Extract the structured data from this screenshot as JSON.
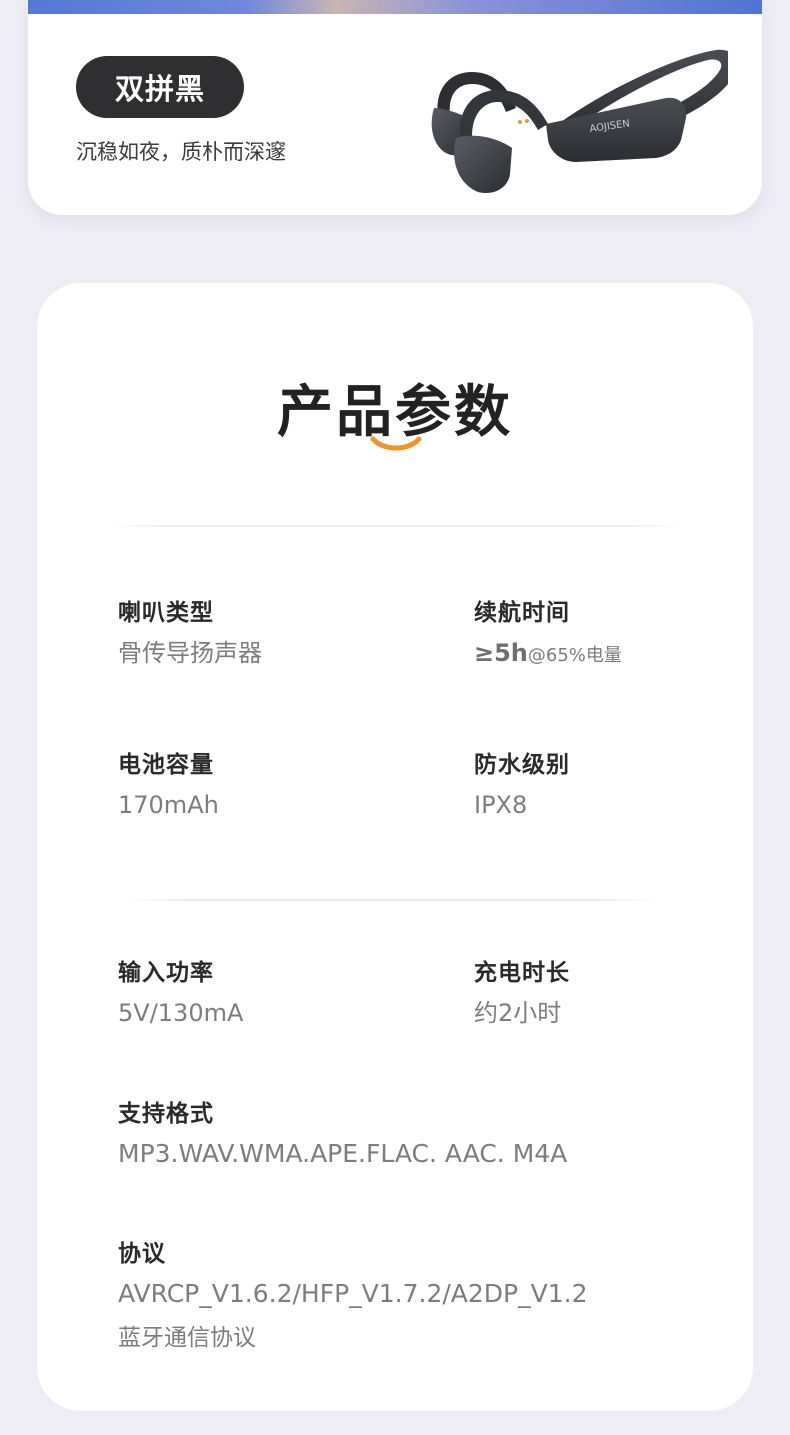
{
  "color_card": {
    "variant_label": "双拼黑",
    "description": "沉稳如夜，质朴而深邃",
    "brand_mark": "AOJISEN"
  },
  "specs": {
    "title": "产品参数",
    "items": [
      {
        "label": "喇叭类型",
        "value": "骨传导扬声器"
      },
      {
        "label": "续航时间",
        "value_strong": "≥5h",
        "value_small": "@65%电量"
      },
      {
        "label": "电池容量",
        "value": "170mAh"
      },
      {
        "label": "防水级别",
        "value": "IPX8"
      },
      {
        "label": "输入功率",
        "value": "5V/130mA"
      },
      {
        "label": "充电时长",
        "value": "约2小时"
      },
      {
        "label": "支持格式",
        "value": "MP3.WAV.WMA.APE.FLAC. AAC. M4A"
      },
      {
        "label": "协议",
        "value": "AVRCP_V1.6.2/HFP_V1.7.2/A2DP_V1.2",
        "sub": "蓝牙通信协议"
      }
    ]
  },
  "colors": {
    "page_bg": "#eeecf5",
    "pill_bg": "#2f2f31",
    "accent_smile": "#f0932b"
  },
  "icons": {
    "product": "bone-conduction-headphone-icon",
    "smile": "smile-curve-icon"
  }
}
